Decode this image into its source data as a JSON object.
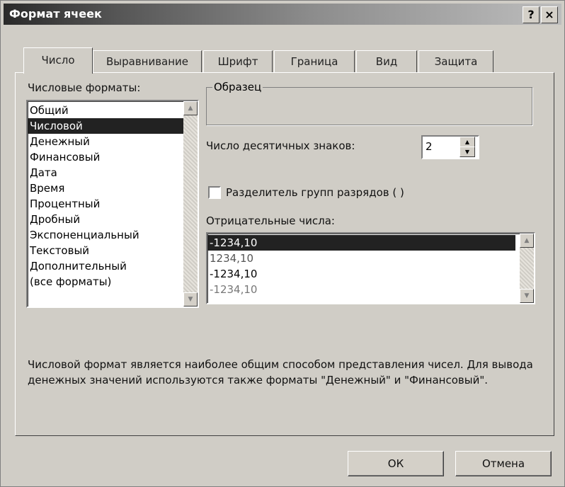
{
  "window": {
    "title": "Формат ячеек",
    "help_button": "?",
    "close_button": "×"
  },
  "tabs": [
    {
      "label": "Число",
      "active": true
    },
    {
      "label": "Выравнивание",
      "active": false
    },
    {
      "label": "Шрифт",
      "active": false
    },
    {
      "label": "Граница",
      "active": false
    },
    {
      "label": "Вид",
      "active": false
    },
    {
      "label": "Защита",
      "active": false
    }
  ],
  "number_formats": {
    "label": "Числовые форматы:",
    "items": [
      "Общий",
      "Числовой",
      "Денежный",
      "Финансовый",
      "Дата",
      "Время",
      "Процентный",
      "Дробный",
      "Экспоненциальный",
      "Текстовый",
      "Дополнительный",
      "(все форматы)"
    ],
    "selected": "Числовой"
  },
  "sample": {
    "label": "Образец",
    "value": ""
  },
  "decimals": {
    "label": "Число десятичных знаков:",
    "value": "2"
  },
  "separator": {
    "label": "Разделитель групп разрядов ( )",
    "checked": false
  },
  "negative_numbers": {
    "label": "Отрицательные числа:",
    "items": [
      "-1234,10",
      "1234,10",
      "-1234,10",
      "-1234,10"
    ],
    "selected_index": 0
  },
  "description": "Числовой формат является наиболее общим способом представления чисел. Для вывода денежных значений используются также форматы \"Денежный\" и \"Финансовый\".",
  "buttons": {
    "ok": "ОК",
    "cancel": "Отмена"
  }
}
